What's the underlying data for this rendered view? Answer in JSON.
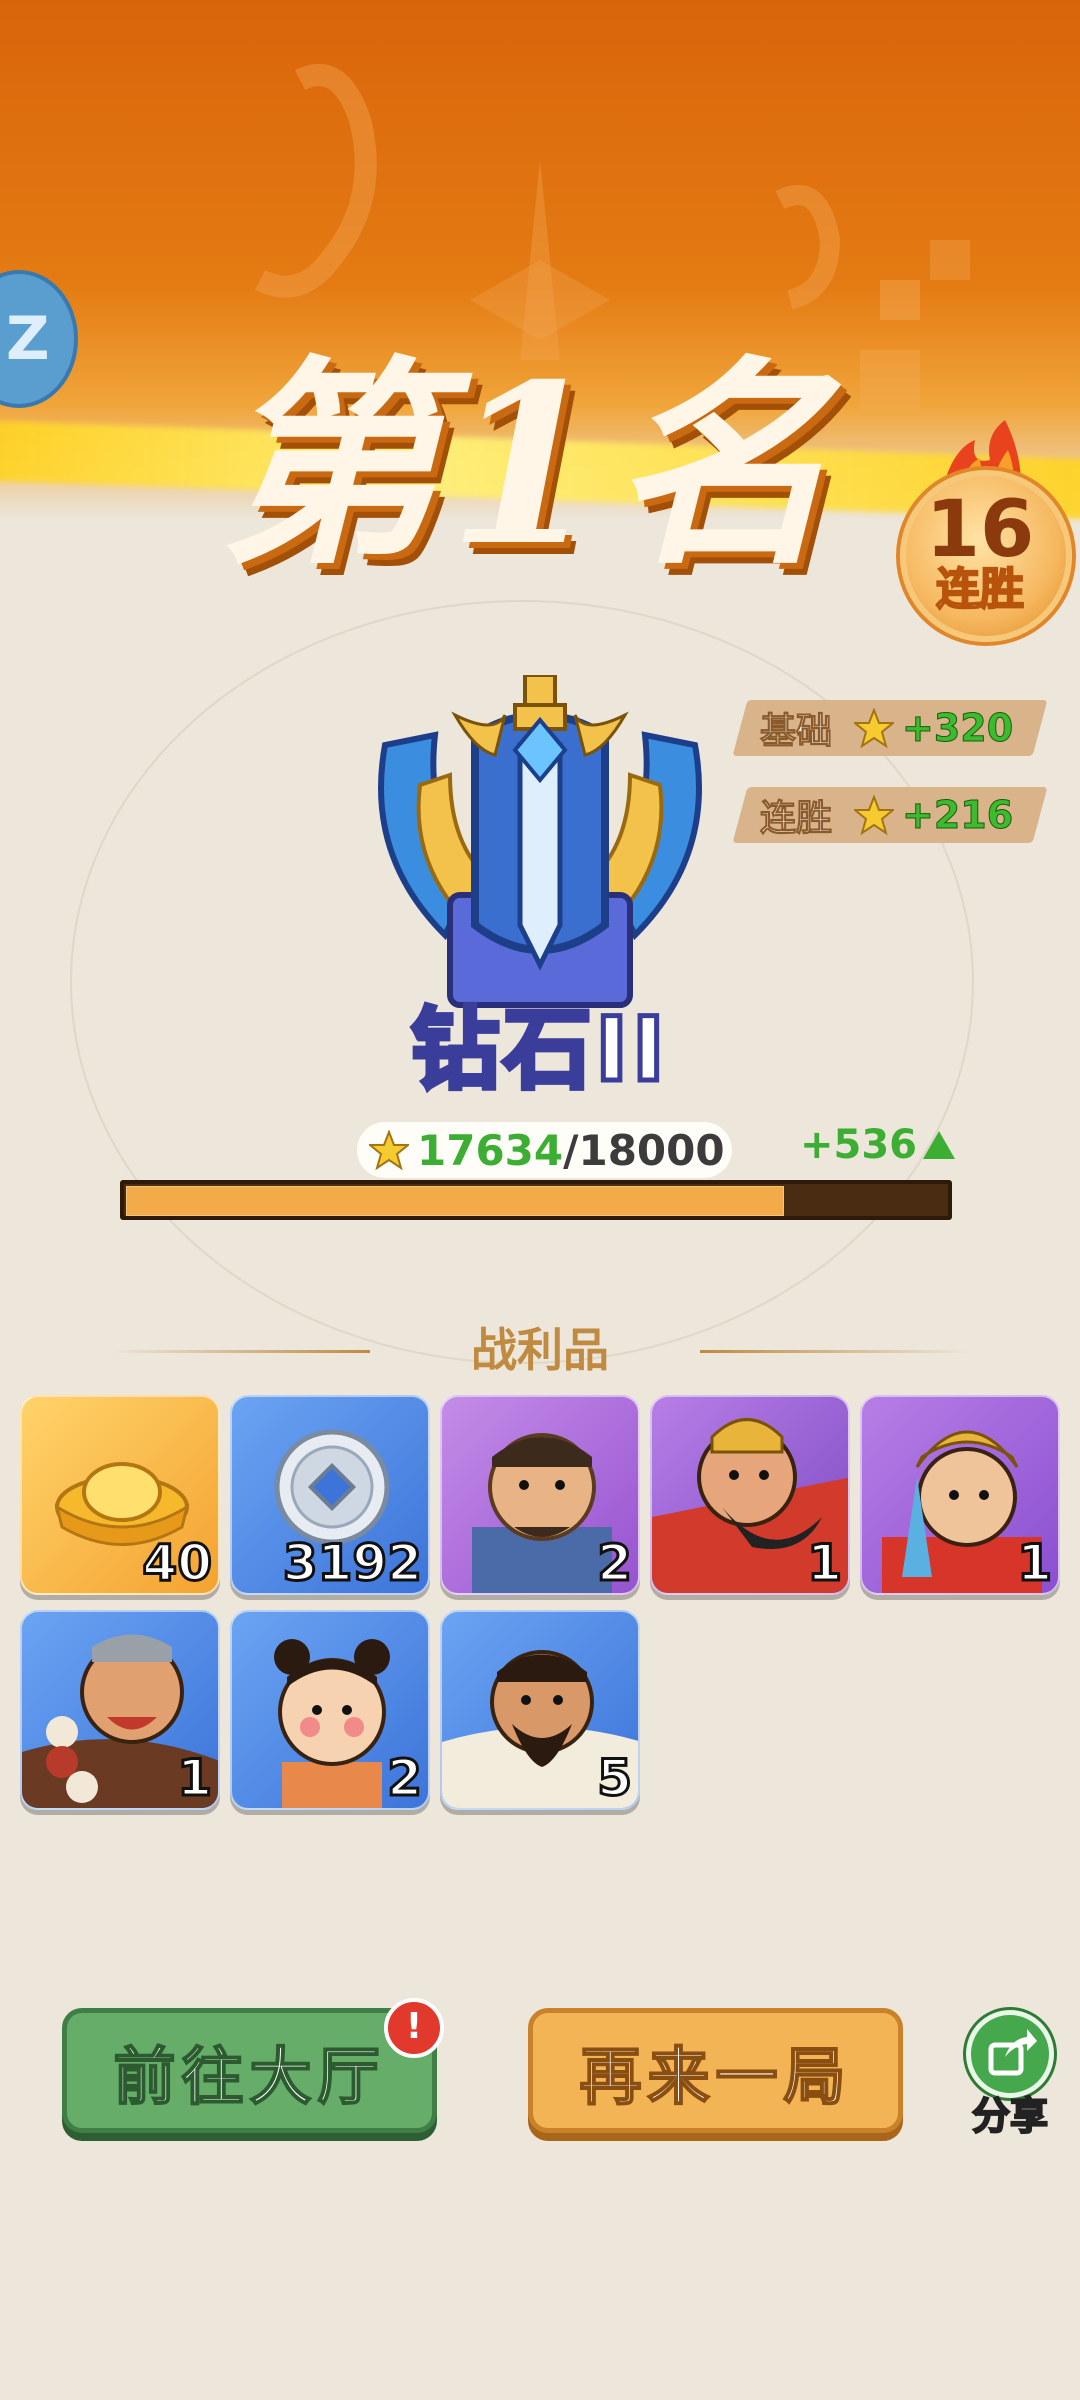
{
  "result": {
    "title": "第1名",
    "streak_count": "16",
    "streak_label": "连胜"
  },
  "rewards": [
    {
      "label": "基础",
      "value": "+320"
    },
    {
      "label": "连胜",
      "value": "+216"
    }
  ],
  "rank": {
    "name": "钻石II",
    "points_current": "17634",
    "points_separator": "/",
    "points_max": "18000",
    "points_gain": "+536",
    "progress_fraction": 0.8
  },
  "loot": {
    "title": "战利品",
    "items": [
      {
        "name": "gold-ingot",
        "quantity": "40"
      },
      {
        "name": "silver-coin",
        "quantity": "3192"
      },
      {
        "name": "hero-general-1",
        "quantity": "2"
      },
      {
        "name": "hero-warrior-2",
        "quantity": "1"
      },
      {
        "name": "hero-commander-3",
        "quantity": "1"
      },
      {
        "name": "hero-monk-4",
        "quantity": "1"
      },
      {
        "name": "hero-child-5",
        "quantity": "2"
      },
      {
        "name": "hero-general-6",
        "quantity": "5"
      }
    ]
  },
  "actions": {
    "lobby_label": "前往大厅",
    "lobby_alert": "!",
    "again_label": "再来一局",
    "share_label": "分享"
  },
  "colors": {
    "banner": "#e47b13",
    "gain_green": "#3dae34",
    "progress_fill": "#f2ab48",
    "lobby_button": "#66ad6a",
    "again_button": "#f2b455"
  }
}
